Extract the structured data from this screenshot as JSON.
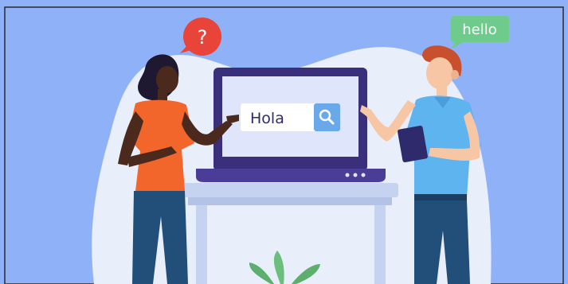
{
  "illustration": {
    "left_speech_bubble": {
      "text": "?",
      "color": "#E8443A"
    },
    "right_speech_bubble": {
      "text": "hello",
      "color": "#6ECB8C"
    },
    "search_box": {
      "query": "Hola",
      "button_icon": "search-icon",
      "button_color": "#6AA9E9"
    },
    "colors": {
      "background": "#8EB1F7",
      "blob": "#E9EEFB",
      "laptop": "#3A2F7A",
      "screen": "#DFE6FB",
      "table": "#C5D3F1",
      "woman_shirt": "#F2662B",
      "man_shirt": "#5DB4EE",
      "pants": "#214F7A",
      "plant": "#6BBE7B"
    }
  }
}
